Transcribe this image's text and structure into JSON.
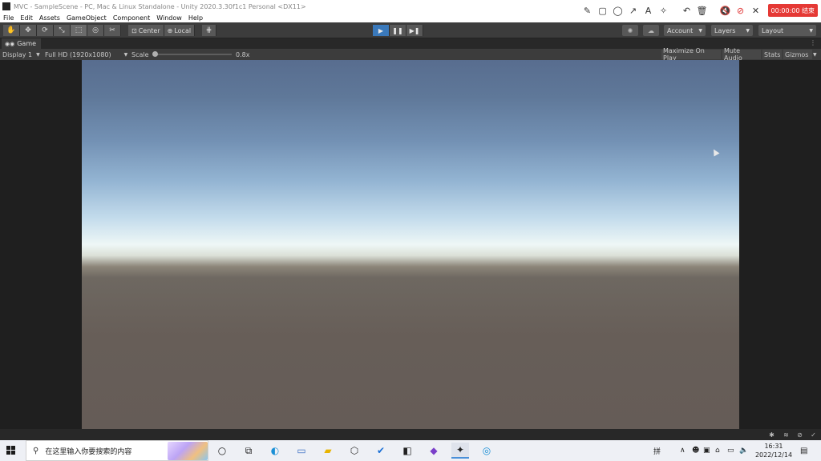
{
  "window": {
    "title": "MVC - SampleScene - PC, Mac & Linux Standalone - Unity 2020.3.30f1c1 Personal <DX11>"
  },
  "menu": [
    "File",
    "Edit",
    "Assets",
    "GameObject",
    "Component",
    "Window",
    "Help"
  ],
  "recorder": {
    "timer": "00:00:00 结束",
    "tools": [
      "pencil-icon",
      "rectangle-icon",
      "circle-icon",
      "arrow-icon",
      "text-icon",
      "magic-wand-icon",
      "undo-icon",
      "trash-icon",
      "speaker-muted-icon",
      "mic-muted-icon",
      "close-icon"
    ]
  },
  "toolbar": {
    "tools": [
      {
        "name": "hand-tool",
        "glyph": "✋"
      },
      {
        "name": "move-tool",
        "glyph": "✥"
      },
      {
        "name": "rotate-tool",
        "glyph": "⟳"
      },
      {
        "name": "scale-tool",
        "glyph": "⤡"
      },
      {
        "name": "rect-tool",
        "glyph": "⬚"
      },
      {
        "name": "transform-tool",
        "glyph": "◎"
      },
      {
        "name": "custom-tool",
        "glyph": "✂"
      }
    ],
    "pivot_label": "Center",
    "rotation_label": "Local",
    "account_label": "Account",
    "layers_label": "Layers",
    "layout_label": "Layout"
  },
  "game_tab": {
    "label": "Game"
  },
  "game_view": {
    "display": "Display 1",
    "resolution": "Full HD (1920x1080)",
    "scale_label": "Scale",
    "scale_value": "0.8x",
    "maximize": "Maximize On Play",
    "mute": "Mute Audio",
    "stats": "Stats",
    "gizmos": "Gizmos"
  },
  "taskbar": {
    "search_placeholder": "在这里输入你要搜索的内容",
    "ime": "拼",
    "time": "16:31",
    "date": "2022/12/14"
  }
}
